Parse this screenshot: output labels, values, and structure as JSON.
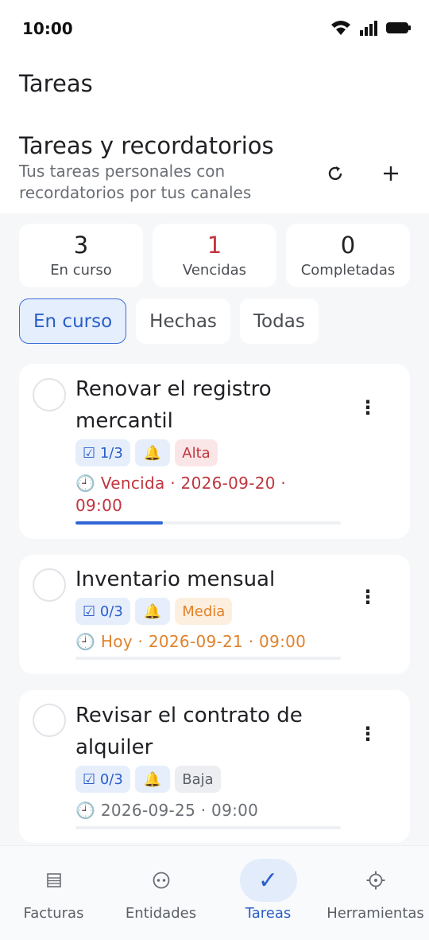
{
  "status_bar": {
    "time": "10:00"
  },
  "header": {
    "app_title": "Tareas",
    "section_title": "Tareas y recordatorios",
    "section_subtitle": "Tus tareas personales con recordatorios por tus canales",
    "refresh_icon": "refresh-icon",
    "add_icon": "add-icon"
  },
  "stats": [
    {
      "value": "3",
      "label": "En curso"
    },
    {
      "value": "1",
      "label": "Vencidas",
      "color": "#c0353e"
    },
    {
      "value": "0",
      "label": "Completadas"
    }
  ],
  "filters": {
    "selected": "En curso",
    "items": [
      "En curso",
      "Hechas",
      "Todas"
    ]
  },
  "tasks": [
    {
      "title": "Renovar el registro mercantil",
      "subtasks": "☑ 1/3",
      "reminder_icon": "bell-icon",
      "priority": "Alta",
      "date": "🕘 Vencida · 2026-09-20 · 09:00",
      "progress": 0.33
    },
    {
      "title": "Inventario mensual",
      "subtasks": "☑ 0/3",
      "reminder_icon": "bell-icon",
      "priority": "Media",
      "date": "🕘 Hoy · 2026-09-21 · 09:00",
      "progress": 0
    },
    {
      "title": "Revisar el contrato de alquiler",
      "subtasks": "☑ 0/3",
      "reminder_icon": "bell-icon",
      "priority": "Baja",
      "date": "🕘 2026-09-25 · 09:00",
      "progress": 0
    }
  ],
  "bottom_nav": {
    "active": "Tareas",
    "items": [
      {
        "label": "Facturas",
        "icon": "invoice-icon"
      },
      {
        "label": "Entidades",
        "icon": "entities-icon"
      },
      {
        "label": "Tareas",
        "icon": "check-icon"
      },
      {
        "label": "Herramientas",
        "icon": "tools-icon"
      }
    ]
  },
  "colors": {
    "accent": "#2f66d8",
    "overdue": "#c0353e",
    "today": "#e0822c",
    "background": "#f6f7f9"
  }
}
